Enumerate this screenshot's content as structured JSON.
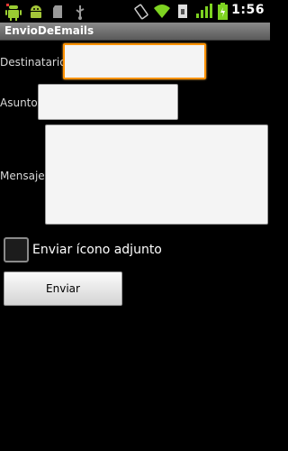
{
  "status_bar": {
    "time": "1:56",
    "icons": [
      "android-icon",
      "sd-card-icon",
      "usb-icon",
      "rotation-icon",
      "wifi-icon",
      "battery-icon",
      "signal-icon",
      "battery-charging-icon"
    ]
  },
  "title_bar": {
    "title": "EnvioDeEmails"
  },
  "form": {
    "destinatario": {
      "label": "Destinatario",
      "value": ""
    },
    "asunto": {
      "label": "Asunto",
      "value": ""
    },
    "mensaje": {
      "label": "Mensaje",
      "value": ""
    },
    "attach_checkbox": {
      "label": "Enviar ícono adjunto",
      "checked": false
    },
    "send_button": {
      "label": "Enviar"
    }
  },
  "colors": {
    "background": "#000000",
    "title_bar": "#6f6f6f",
    "focus_accent": "#ff9200",
    "status_green": "#7ed321"
  }
}
